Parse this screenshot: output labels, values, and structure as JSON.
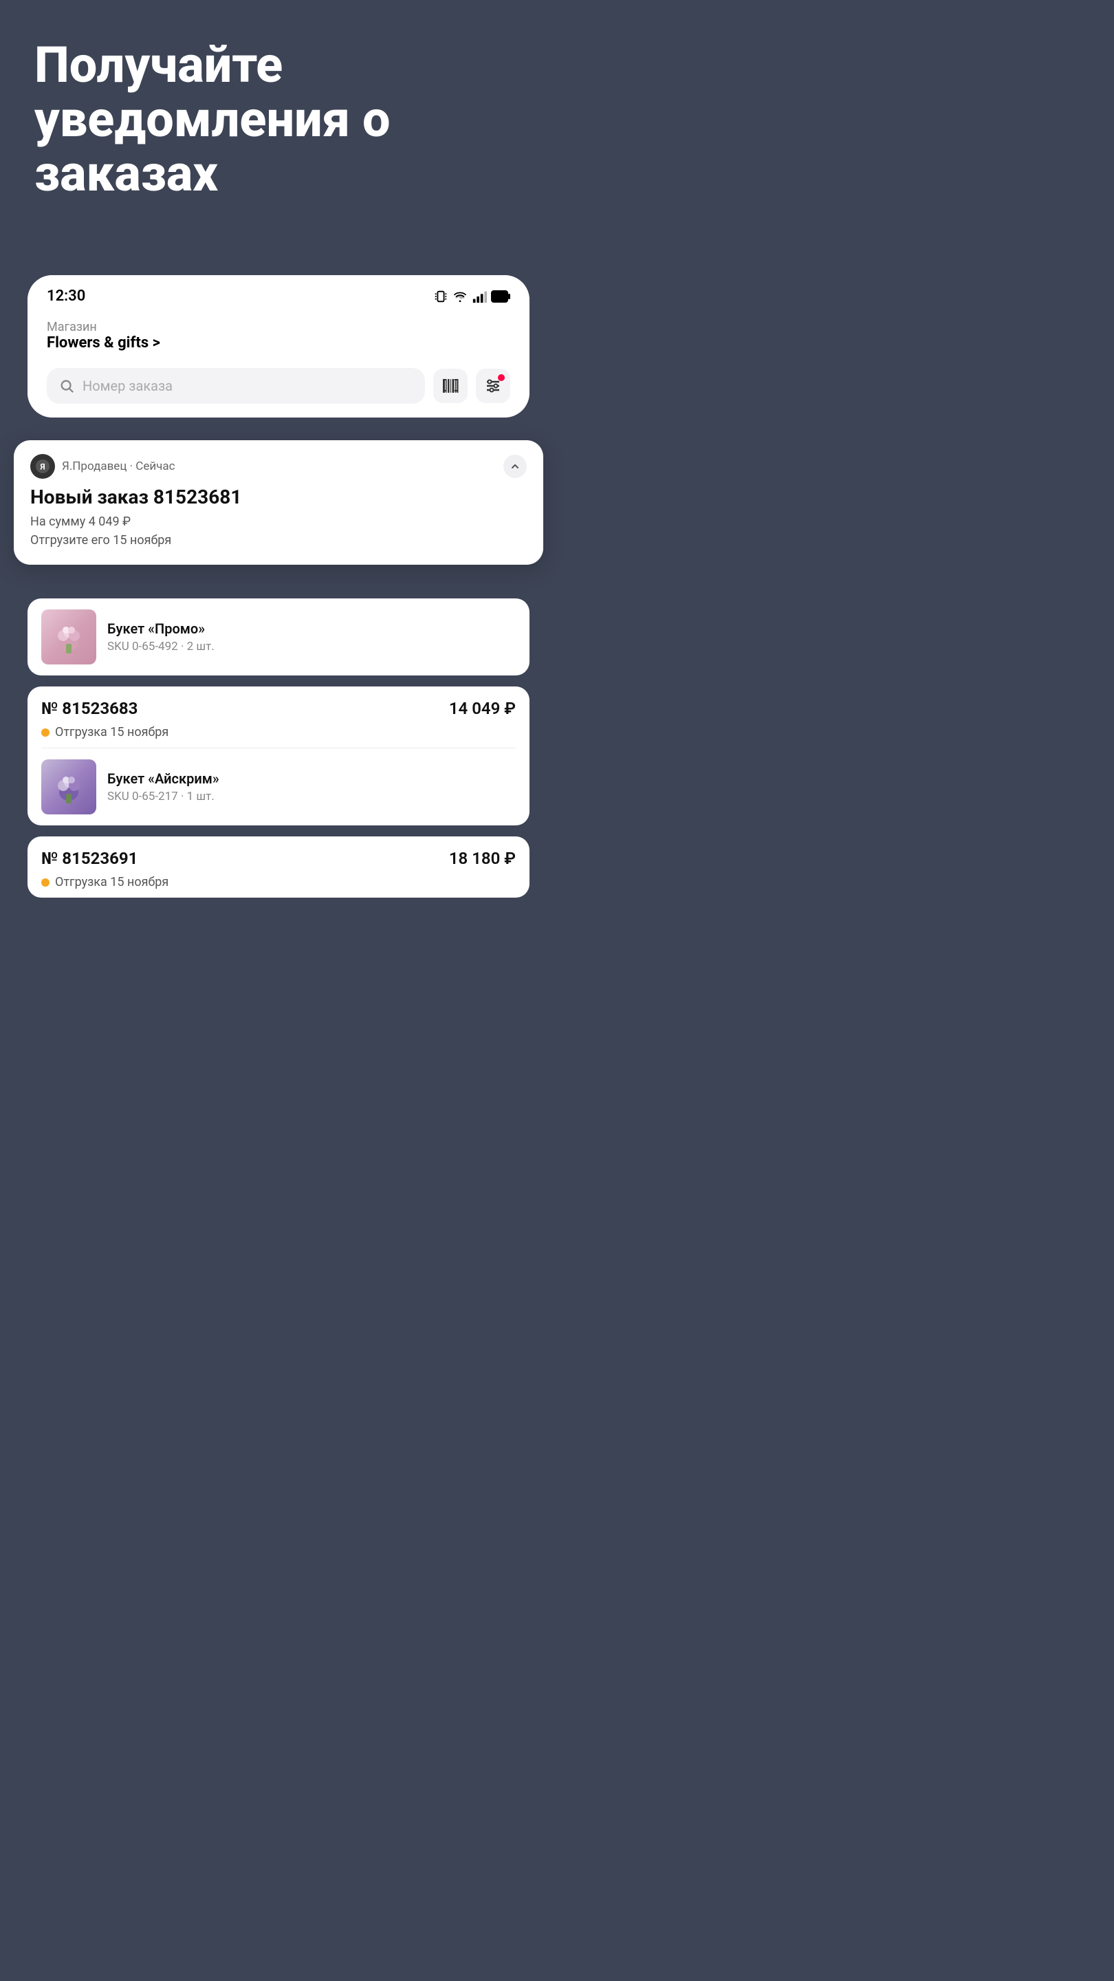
{
  "hero": {
    "title": "Получайте уведомления о заказах"
  },
  "phone": {
    "statusBar": {
      "time": "12:30",
      "icons": [
        "vibrate",
        "wifi",
        "signal",
        "battery"
      ]
    },
    "store": {
      "label": "Магазин",
      "name": "Flowers & gifts >"
    },
    "search": {
      "placeholder": "Номер заказа"
    }
  },
  "notification": {
    "appName": "Я.Продавец",
    "time": "Сейчас",
    "title": "Новый заказ 81523681",
    "line1": "На сумму 4 049 ₽",
    "line2": "Отгрузите его 15 ноября"
  },
  "orderItems": [
    {
      "name": "Букет «Промо»",
      "sku": "SKU 0-65-492 · 2 шт.",
      "imageType": "pink"
    }
  ],
  "orders": [
    {
      "number": "№ 81523683",
      "price": "14 049 ₽",
      "status": "Отгрузка 15 ноября",
      "items": [
        {
          "name": "Букет «Айскрим»",
          "sku": "SKU 0-65-217 · 1 шт.",
          "imageType": "purple"
        }
      ]
    },
    {
      "number": "№ 81523691",
      "price": "18 180 ₽",
      "status": "Отгрузка 15 ноября",
      "items": []
    }
  ]
}
